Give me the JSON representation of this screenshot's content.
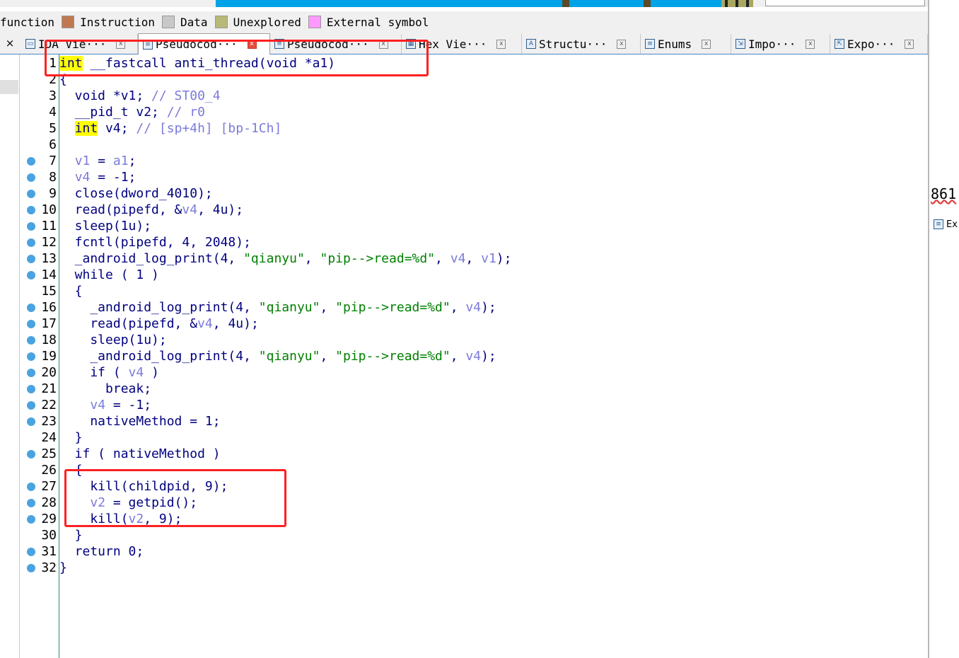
{
  "colors": {
    "nav_blue": "#00a2e8",
    "nav_dark": "#5a4a2a",
    "nav_olive": "#a8a860",
    "instruction": "#c07850",
    "data": "#c8c8c8",
    "unexplored": "#b8b878",
    "external_symbol": "#ff99ff",
    "keyword": "#000080",
    "variable": "#7b7bd9",
    "string": "#008000",
    "highlight": "#ffff00",
    "annotation": "#ff2020"
  },
  "legend": [
    {
      "label": "function",
      "swatch": ""
    },
    {
      "label": "Instruction",
      "swatch": "#c07850"
    },
    {
      "label": "Data",
      "swatch": "#c8c8c8"
    },
    {
      "label": "Unexplored",
      "swatch": "#b8b878"
    },
    {
      "label": "External symbol",
      "swatch": "#ff99ff"
    }
  ],
  "tabs": [
    {
      "label": "IDA Vie···",
      "icon": "window-icon",
      "close": "x"
    },
    {
      "label": "Pseudocod···",
      "icon": "code-icon",
      "close": "x",
      "active": true
    },
    {
      "label": "Pseudocod···",
      "icon": "code-icon",
      "close": "x"
    },
    {
      "label": "Hex Vie···",
      "icon": "hex-icon",
      "close": "x"
    },
    {
      "label": "Structu···",
      "icon": "struct-icon",
      "close": "x"
    },
    {
      "label": "Enums",
      "icon": "enum-icon",
      "close": "x"
    },
    {
      "label": "Impo···",
      "icon": "import-icon",
      "close": "x"
    },
    {
      "label": "Expo···",
      "icon": "export-icon",
      "close": "x"
    }
  ],
  "left_close": "×",
  "right_panel": {
    "number": "861",
    "tab_label": "Ex"
  },
  "code": [
    {
      "n": "1",
      "bp": false,
      "tokens": [
        [
          "kwt",
          "int"
        ],
        [
          "plain",
          " __fastcall anti_thread(void *a1)"
        ]
      ]
    },
    {
      "n": "2",
      "bp": false,
      "tokens": [
        [
          "plain",
          "{"
        ]
      ]
    },
    {
      "n": "3",
      "bp": false,
      "tokens": [
        [
          "plain",
          "  void *v1; "
        ],
        [
          "cmt",
          "// ST00_4"
        ]
      ]
    },
    {
      "n": "4",
      "bp": false,
      "tokens": [
        [
          "plain",
          "  __pid_t v2; "
        ],
        [
          "cmt",
          "// r0"
        ]
      ]
    },
    {
      "n": "5",
      "bp": false,
      "tokens": [
        [
          "plain",
          "  "
        ],
        [
          "kwt",
          "int"
        ],
        [
          "plain",
          " v4; "
        ],
        [
          "cmt",
          "// [sp+4h] [bp-1Ch]"
        ]
      ]
    },
    {
      "n": "6",
      "bp": false,
      "tokens": []
    },
    {
      "n": "7",
      "bp": true,
      "tokens": [
        [
          "plain",
          "  "
        ],
        [
          "var",
          "v1"
        ],
        [
          "plain",
          " = "
        ],
        [
          "var",
          "a1"
        ],
        [
          "plain",
          ";"
        ]
      ]
    },
    {
      "n": "8",
      "bp": true,
      "tokens": [
        [
          "plain",
          "  "
        ],
        [
          "var",
          "v4"
        ],
        [
          "plain",
          " = -1;"
        ]
      ]
    },
    {
      "n": "9",
      "bp": true,
      "tokens": [
        [
          "plain",
          "  close(dword_4010);"
        ]
      ]
    },
    {
      "n": "10",
      "bp": true,
      "tokens": [
        [
          "plain",
          "  read(pipefd, &"
        ],
        [
          "var",
          "v4"
        ],
        [
          "plain",
          ", 4u);"
        ]
      ]
    },
    {
      "n": "11",
      "bp": true,
      "tokens": [
        [
          "plain",
          "  sleep(1u);"
        ]
      ]
    },
    {
      "n": "12",
      "bp": true,
      "tokens": [
        [
          "plain",
          "  fcntl(pipefd, 4, 2048);"
        ]
      ]
    },
    {
      "n": "13",
      "bp": true,
      "tokens": [
        [
          "plain",
          "  _android_log_print(4, "
        ],
        [
          "str",
          "\"qianyu\""
        ],
        [
          "plain",
          ", "
        ],
        [
          "str",
          "\"pip-->read=%d\""
        ],
        [
          "plain",
          ", "
        ],
        [
          "var",
          "v4"
        ],
        [
          "plain",
          ", "
        ],
        [
          "var",
          "v1"
        ],
        [
          "plain",
          ");"
        ]
      ]
    },
    {
      "n": "14",
      "bp": true,
      "tokens": [
        [
          "plain",
          "  while ( 1 )"
        ]
      ]
    },
    {
      "n": "15",
      "bp": false,
      "tokens": [
        [
          "plain",
          "  {"
        ]
      ]
    },
    {
      "n": "16",
      "bp": true,
      "tokens": [
        [
          "plain",
          "    _android_log_print(4, "
        ],
        [
          "str",
          "\"qianyu\""
        ],
        [
          "plain",
          ", "
        ],
        [
          "str",
          "\"pip-->read=%d\""
        ],
        [
          "plain",
          ", "
        ],
        [
          "var",
          "v4"
        ],
        [
          "plain",
          ");"
        ]
      ]
    },
    {
      "n": "17",
      "bp": true,
      "tokens": [
        [
          "plain",
          "    read(pipefd, &"
        ],
        [
          "var",
          "v4"
        ],
        [
          "plain",
          ", 4u);"
        ]
      ]
    },
    {
      "n": "18",
      "bp": true,
      "tokens": [
        [
          "plain",
          "    sleep(1u);"
        ]
      ]
    },
    {
      "n": "19",
      "bp": true,
      "tokens": [
        [
          "plain",
          "    _android_log_print(4, "
        ],
        [
          "str",
          "\"qianyu\""
        ],
        [
          "plain",
          ", "
        ],
        [
          "str",
          "\"pip-->read=%d\""
        ],
        [
          "plain",
          ", "
        ],
        [
          "var",
          "v4"
        ],
        [
          "plain",
          ");"
        ]
      ]
    },
    {
      "n": "20",
      "bp": true,
      "tokens": [
        [
          "plain",
          "    if ( "
        ],
        [
          "var",
          "v4"
        ],
        [
          "plain",
          " )"
        ]
      ]
    },
    {
      "n": "21",
      "bp": true,
      "tokens": [
        [
          "plain",
          "      break;"
        ]
      ]
    },
    {
      "n": "22",
      "bp": true,
      "tokens": [
        [
          "plain",
          "    "
        ],
        [
          "var",
          "v4"
        ],
        [
          "plain",
          " = -1;"
        ]
      ]
    },
    {
      "n": "23",
      "bp": true,
      "tokens": [
        [
          "plain",
          "    nativeMethod = 1;"
        ]
      ]
    },
    {
      "n": "24",
      "bp": false,
      "tokens": [
        [
          "plain",
          "  }"
        ]
      ]
    },
    {
      "n": "25",
      "bp": true,
      "tokens": [
        [
          "plain",
          "  if ( nativeMethod )"
        ]
      ]
    },
    {
      "n": "26",
      "bp": false,
      "tokens": [
        [
          "plain",
          "  {"
        ]
      ]
    },
    {
      "n": "27",
      "bp": true,
      "tokens": [
        [
          "plain",
          "    kill(childpid, 9);"
        ]
      ]
    },
    {
      "n": "28",
      "bp": true,
      "tokens": [
        [
          "plain",
          "    "
        ],
        [
          "var",
          "v2"
        ],
        [
          "plain",
          " = getpid();"
        ]
      ]
    },
    {
      "n": "29",
      "bp": true,
      "tokens": [
        [
          "plain",
          "    kill("
        ],
        [
          "var",
          "v2"
        ],
        [
          "plain",
          ", 9);"
        ]
      ]
    },
    {
      "n": "30",
      "bp": false,
      "tokens": [
        [
          "plain",
          "  }"
        ]
      ]
    },
    {
      "n": "31",
      "bp": true,
      "tokens": [
        [
          "plain",
          "  return 0;"
        ]
      ]
    },
    {
      "n": "32",
      "bp": true,
      "tokens": [
        [
          "plain",
          "}"
        ]
      ]
    }
  ]
}
